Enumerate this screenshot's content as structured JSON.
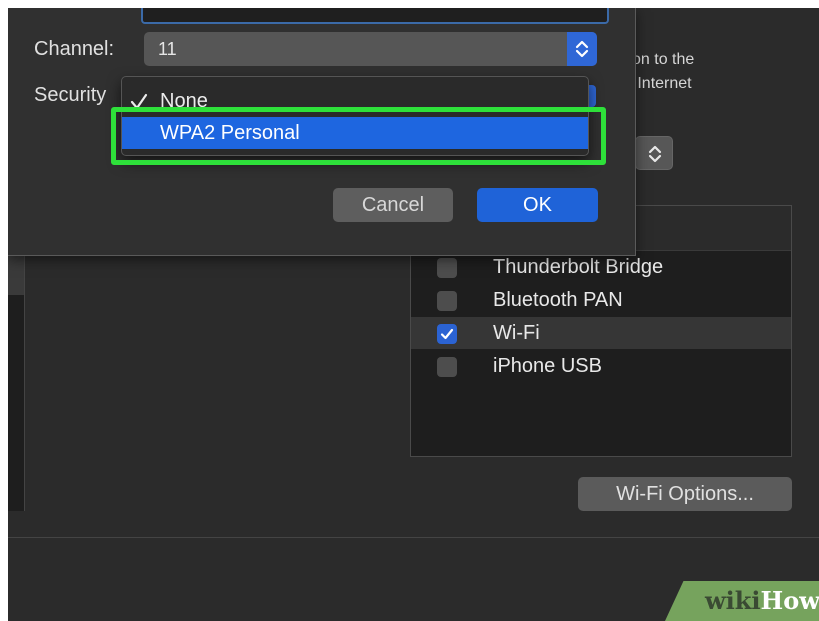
{
  "dialog": {
    "channel_label": "Channel:",
    "channel_value": "11",
    "security_label": "Security",
    "cancel_label": "Cancel",
    "ok_label": "OK"
  },
  "security_menu": {
    "items": [
      {
        "label": "None",
        "checked": true,
        "highlighted": false
      },
      {
        "label": "WPA2 Personal",
        "checked": false,
        "highlighted": true
      }
    ]
  },
  "background": {
    "description_lines": [
      "tion to the",
      "e Internet"
    ],
    "ports": [
      {
        "label": "Thunderbolt Bridge",
        "checked": false
      },
      {
        "label": "Bluetooth PAN",
        "checked": false
      },
      {
        "label": "Wi-Fi",
        "checked": true
      },
      {
        "label": "iPhone USB",
        "checked": false
      }
    ],
    "wifi_options_label": "Wi-Fi Options..."
  },
  "watermark": {
    "part1": "wiki",
    "part2": "How"
  },
  "colors": {
    "accent": "#1e66e0",
    "highlight_box": "#2ee03a",
    "checkbox_on": "#2b63d3"
  },
  "icons": [
    "up-down-chevron-icon",
    "checkmark-icon"
  ]
}
